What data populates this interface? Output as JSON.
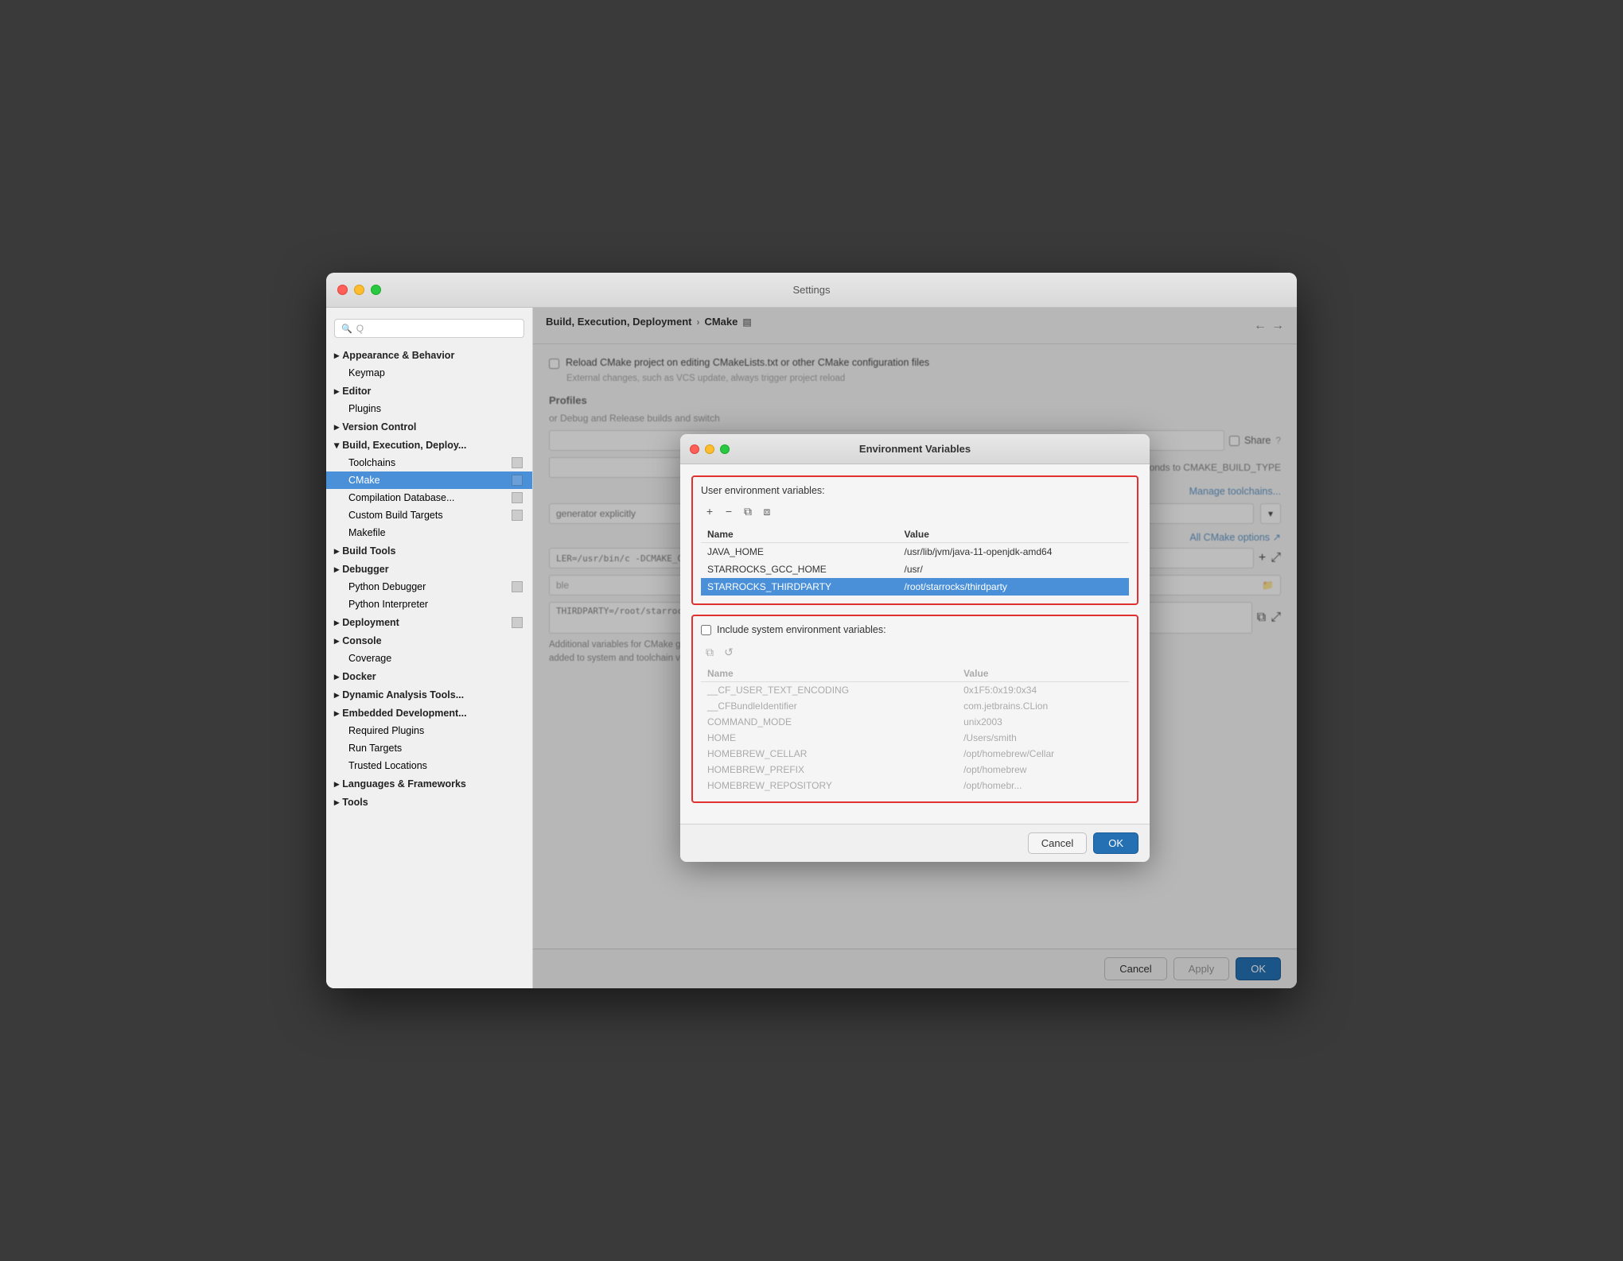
{
  "window": {
    "title": "Settings",
    "buttons": {
      "close": "close",
      "min": "minimize",
      "max": "maximize"
    }
  },
  "sidebar": {
    "search_placeholder": "Q",
    "items": [
      {
        "id": "appearance",
        "label": "Appearance & Behavior",
        "level": 0,
        "type": "section",
        "arrow": "▸",
        "has_icon": false
      },
      {
        "id": "keymap",
        "label": "Keymap",
        "level": 1,
        "type": "item",
        "has_icon": false
      },
      {
        "id": "editor",
        "label": "Editor",
        "level": 0,
        "type": "section",
        "arrow": "▸",
        "has_icon": false
      },
      {
        "id": "plugins",
        "label": "Plugins",
        "level": 1,
        "type": "item",
        "has_icon": false
      },
      {
        "id": "version-control",
        "label": "Version Control",
        "level": 0,
        "type": "section",
        "arrow": "▸",
        "has_icon": false
      },
      {
        "id": "build-exec",
        "label": "Build, Execution, Deploy...",
        "level": 0,
        "type": "section",
        "arrow": "▾",
        "has_icon": false
      },
      {
        "id": "toolchains",
        "label": "Toolchains",
        "level": 1,
        "type": "item",
        "has_icon": true
      },
      {
        "id": "cmake",
        "label": "CMake",
        "level": 1,
        "type": "item",
        "selected": true,
        "has_icon": true
      },
      {
        "id": "compilation-db",
        "label": "Compilation Database...",
        "level": 1,
        "type": "item",
        "has_icon": true
      },
      {
        "id": "custom-build-targets",
        "label": "Custom Build Targets",
        "level": 1,
        "type": "item",
        "has_icon": true
      },
      {
        "id": "makefile",
        "label": "Makefile",
        "level": 1,
        "type": "item",
        "has_icon": false
      },
      {
        "id": "build-tools",
        "label": "Build Tools",
        "level": 0,
        "type": "section",
        "arrow": "▸",
        "has_icon": false
      },
      {
        "id": "debugger",
        "label": "Debugger",
        "level": 0,
        "type": "section",
        "arrow": "▸",
        "has_icon": false
      },
      {
        "id": "python-debugger",
        "label": "Python Debugger",
        "level": 1,
        "type": "item",
        "has_icon": true
      },
      {
        "id": "python-interpreter",
        "label": "Python Interpreter",
        "level": 1,
        "type": "item",
        "has_icon": false
      },
      {
        "id": "deployment",
        "label": "Deployment",
        "level": 0,
        "type": "section",
        "arrow": "▸",
        "has_icon": false
      },
      {
        "id": "console",
        "label": "Console",
        "level": 0,
        "type": "section",
        "arrow": "▸",
        "has_icon": false
      },
      {
        "id": "coverage",
        "label": "Coverage",
        "level": 1,
        "type": "item",
        "has_icon": false
      },
      {
        "id": "docker",
        "label": "Docker",
        "level": 0,
        "type": "section",
        "arrow": "▸",
        "has_icon": false
      },
      {
        "id": "dynamic-analysis",
        "label": "Dynamic Analysis Tools...",
        "level": 0,
        "type": "section",
        "arrow": "▸",
        "has_icon": false
      },
      {
        "id": "embedded-dev",
        "label": "Embedded Development...",
        "level": 0,
        "type": "section",
        "arrow": "▸",
        "has_icon": false
      },
      {
        "id": "required-plugins",
        "label": "Required Plugins",
        "level": 1,
        "type": "item",
        "has_icon": false
      },
      {
        "id": "run-targets",
        "label": "Run Targets",
        "level": 1,
        "type": "item",
        "has_icon": false
      },
      {
        "id": "trusted-locations",
        "label": "Trusted Locations",
        "level": 1,
        "type": "item",
        "has_icon": false
      },
      {
        "id": "languages-frameworks",
        "label": "Languages & Frameworks",
        "level": 0,
        "type": "section",
        "arrow": "▸",
        "has_icon": false
      },
      {
        "id": "tools",
        "label": "Tools",
        "level": 0,
        "type": "section",
        "arrow": "▸",
        "has_icon": false
      }
    ]
  },
  "breadcrumb": {
    "part1": "Build, Execution, Deployment",
    "arrow": "›",
    "part2": "CMake",
    "icon": "▤"
  },
  "right_panel": {
    "reload_checkbox": false,
    "reload_label": "Reload CMake project on editing CMakeLists.txt or other CMake configuration files",
    "reload_hint": "External changes, such as VCS update, always trigger project reload",
    "profiles_label": "Profiles",
    "debug_release_hint": "or Debug and Release builds and switch",
    "share_label": "Share",
    "corresponds_label": "Corresponds to CMAKE_BUILD_TYPE",
    "manage_toolchains": "Manage toolchains...",
    "generator_label": "generator explicitly",
    "all_cmake_options": "All CMake options ↗",
    "cmake_options_value": "LER=/usr/bin/c -DCMAKE_CXX_CO",
    "ble_placeholder": "ble",
    "additional_vars_note": "Additional variables for CMake generation and build. The values are",
    "added_note": "added to system and toolchain variables.",
    "thirdparty_value": "THIRDPARTY=/root/starrocks/thirdparty",
    "folder_icon": "📁",
    "expand_icon": "⤢"
  },
  "footer": {
    "cancel_label": "Cancel",
    "apply_label": "Apply",
    "ok_label": "OK"
  },
  "dialog": {
    "title": "Environment Variables",
    "user_env_section_label": "User environment variables:",
    "toolbar": {
      "add": "+",
      "remove": "−",
      "copy": "⧉",
      "paste": "⧈"
    },
    "env_table": {
      "col_name": "Name",
      "col_value": "Value",
      "rows": [
        {
          "name": "JAVA_HOME",
          "value": "/usr/lib/jvm/java-11-openjdk-amd64",
          "selected": false
        },
        {
          "name": "STARROCKS_GCC_HOME",
          "value": "/usr/",
          "selected": false
        },
        {
          "name": "STARROCKS_THIRDPARTY",
          "value": "/root/starrocks/thirdparty",
          "selected": true
        }
      ]
    },
    "include_system_label": "Include system environment variables:",
    "include_system_checked": false,
    "sys_table": {
      "col_name": "Name",
      "col_value": "Value",
      "rows": [
        {
          "name": "__CF_USER_TEXT_ENCODING",
          "value": "0x1F5:0x19:0x34"
        },
        {
          "name": "__CFBundleIdentifier",
          "value": "com.jetbrains.CLion"
        },
        {
          "name": "COMMAND_MODE",
          "value": "unix2003"
        },
        {
          "name": "HOME",
          "value": "/Users/smith"
        },
        {
          "name": "HOMEBREW_CELLAR",
          "value": "/opt/homebrew/Cellar"
        },
        {
          "name": "HOMEBREW_PREFIX",
          "value": "/opt/homebrew"
        },
        {
          "name": "HOMEBREW_REPOSITORY",
          "value": "/opt/homebr..."
        }
      ]
    },
    "cancel_label": "Cancel",
    "ok_label": "OK"
  }
}
